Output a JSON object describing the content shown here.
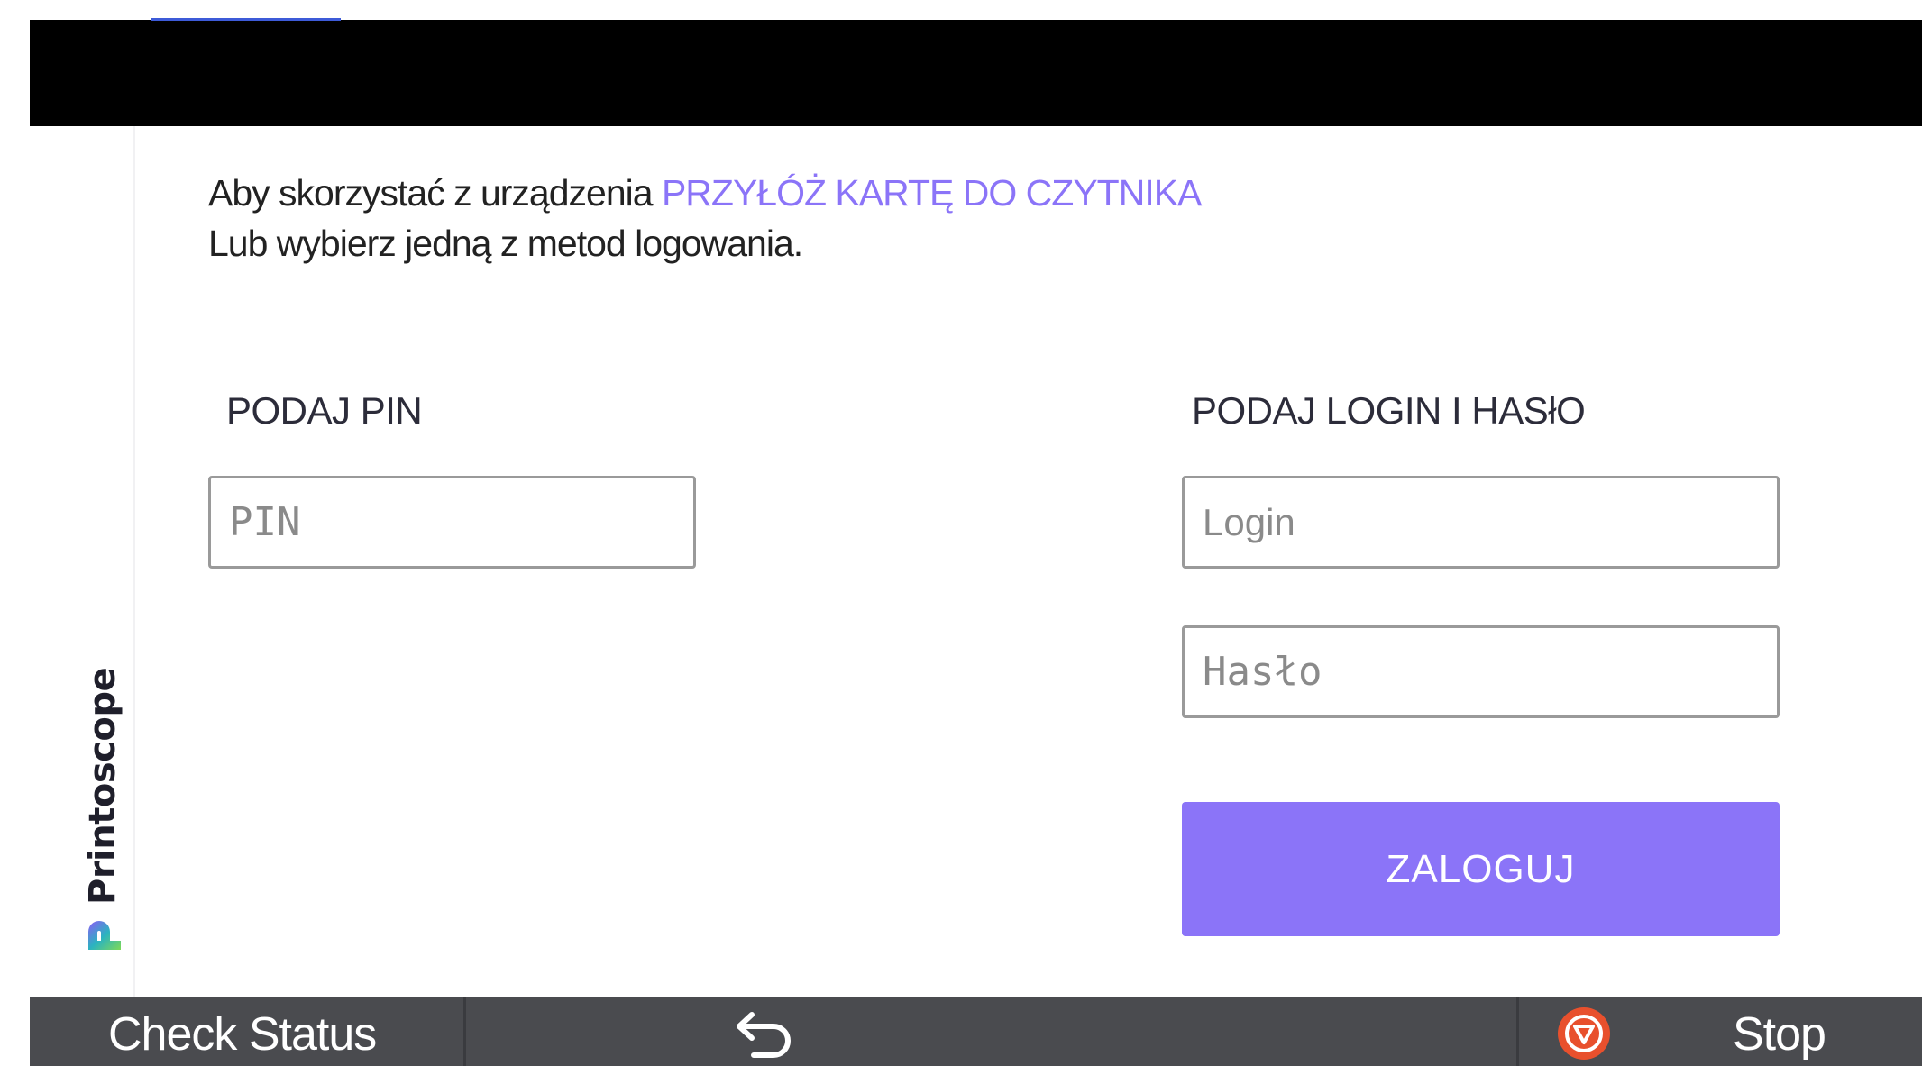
{
  "intro": {
    "line1_prefix": "Aby skorzystać z urządzenia",
    "line1_accent": "PRZYŁÓŻ KARTĘ DO CZYTNIKA",
    "line2": "Lub wybierz jedną z metod logowania."
  },
  "brand": {
    "name": "Printoscope",
    "logo_icon": "printoscope-logo-icon"
  },
  "pin_section": {
    "label": "PODAJ PIN",
    "pin_placeholder": "PIN",
    "pin_value": ""
  },
  "login_section": {
    "label": "PODAJ LOGIN I HASłO",
    "login_placeholder": "Login",
    "login_value": "",
    "password_placeholder": "Hasło",
    "password_value": "",
    "submit_label": "ZALOGUJ"
  },
  "bottom_bar": {
    "check_status_label": "Check Status",
    "back_icon": "back-arrow-icon",
    "stop_icon": "stop-icon",
    "stop_label": "Stop"
  },
  "colors": {
    "accent": "#8b74f8",
    "top_bar": "#000000",
    "bottom_bar": "#4a4b4f",
    "stop_red": "#e8502d"
  }
}
